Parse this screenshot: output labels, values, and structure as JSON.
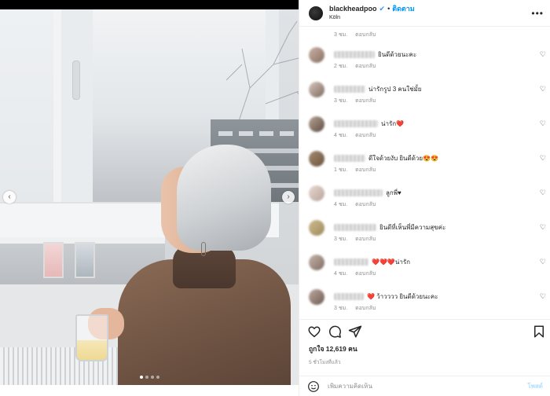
{
  "header": {
    "username": "blackheadpoo",
    "separator": "•",
    "follow_label": "ติดตาม",
    "location": "Köln"
  },
  "photo": {
    "carousel_dots": 4,
    "active_dot": 0
  },
  "top_comment_meta": {
    "time": "3 ชม.",
    "reply": "ตอบกลับ"
  },
  "comments": [
    {
      "text": "ยินดีด้วยนะคะ",
      "time": "2 ชม.",
      "reply": "ตอบกลับ"
    },
    {
      "text": "น่ารักรูป 3 คนใช่มั้ย",
      "time": "3 ชม.",
      "reply": "ตอบกลับ"
    },
    {
      "text": "น่ารัก❤️",
      "time": "4 ชม.",
      "reply": "ตอบกลับ"
    },
    {
      "text": "ดีใจด้วยงับ ยินดีด้วย😍😍",
      "time": "1 ชม.",
      "reply": "ตอบกลับ"
    },
    {
      "text": "ลูกพี่♥",
      "time": "4 ชม.",
      "reply": "ตอบกลับ"
    },
    {
      "text": "ยินดีที่เห็นพี่มีความสุขค่ะ",
      "time": "3 ชม.",
      "reply": "ตอบกลับ"
    },
    {
      "text": "❤️❤️❤️น่ารัก",
      "time": "4 ชม.",
      "reply": "ตอบกลับ"
    },
    {
      "text": "❤️ ว้าวววว ยินดีด้วยนะคะ",
      "time": "3 ชม.",
      "reply": "ตอบกลับ"
    }
  ],
  "stats": {
    "likes": "ถูกใจ 12,619 คน",
    "time_ago": "5 ชั่วโมงที่แล้ว"
  },
  "compose": {
    "placeholder": "เพิ่มความคิดเห็น",
    "post_label": "โพสต์"
  },
  "icons": {
    "like": "heart-icon",
    "comment": "comment-icon",
    "share": "paper-plane-icon",
    "save": "bookmark-icon",
    "emoji": "smiley-icon",
    "more": "more-icon"
  },
  "colors": {
    "accent": "#0095f6",
    "heart": "#ed4956",
    "muted": "#8e8e8e"
  }
}
